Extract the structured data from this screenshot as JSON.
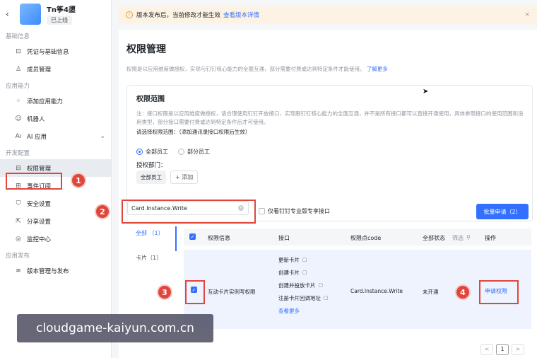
{
  "app": {
    "back": "‹",
    "name": "Tn筝4盨",
    "status": "已上线"
  },
  "sidebar": {
    "group_basic": "基础信息",
    "group_ability": "应用能力",
    "group_dev": "开发配置",
    "group_release": "应用发布",
    "items": {
      "credentials": "凭证与基础信息",
      "members": "成员管理",
      "add_ability": "添加应用能力",
      "robot": "机器人",
      "ai_app": "AI 应用",
      "permissions": "权限管理",
      "events": "事件订阅",
      "security": "安全设置",
      "share": "分享设置",
      "monitor": "监控中心",
      "versions": "版本管理与发布"
    }
  },
  "banner": {
    "text": "版本发布后，当前修改才能生效",
    "link": "查看版本详情",
    "close": "×"
  },
  "page": {
    "title": "权限管理",
    "desc": "权限是以应用维度做授权，实现与钉钉核心能力的全面互通，部分需要付费或达到特定条件才能使用。",
    "desc_link": "了解更多"
  },
  "scope": {
    "title": "权限范围",
    "note": "注：接口权限是以应用维度做授权，请合理使用钉钉开放接口，实现跟钉钉核心能力的全面互通，并不是所有接口都可以直接开通使用，具体参照接口的使用范围和适用类型，部分接口需要付费或达到特定条件后才可使用。",
    "choose": "请选择权限范围：（添加通讯录接口权限后生效）",
    "radio_all": "全部员工",
    "radio_part": "部分员工",
    "dept_label": "授权部门：",
    "dept_tag": "全部员工",
    "add": "+ 添加"
  },
  "search": {
    "value": "Card.Instance.Write"
  },
  "pro_only": "仅看钉钉专业版专享接口",
  "batch_button": "批量申请（2）",
  "tabs": [
    {
      "label": "全部 （1）"
    },
    {
      "label": "卡片（1）"
    }
  ],
  "table": {
    "headers": {
      "info": "权限信息",
      "iface": "接口",
      "code": "权限点code",
      "status": "全部状态",
      "filter": "筛选",
      "ops": "操作"
    },
    "row": {
      "info": "互动卡片实例写权限",
      "interfaces": [
        "更新卡片",
        "创建卡片",
        "创建并投放卡片",
        "注册卡片回调地址"
      ],
      "more": "查看更多",
      "code": "Card.Instance.Write",
      "status": "未开通",
      "action": "申请权限"
    }
  },
  "pager": {
    "prev": "<",
    "page": "1",
    "next": ">"
  },
  "steps": {
    "s1": "1",
    "s2": "2",
    "s3": "3",
    "s4": "4"
  },
  "watermark": "cloudgame-kaiyun.com.cn",
  "colors": {
    "accent": "#3370ff",
    "annotation_red": "#e0463c",
    "banner_bg": "#fdf3e4"
  }
}
